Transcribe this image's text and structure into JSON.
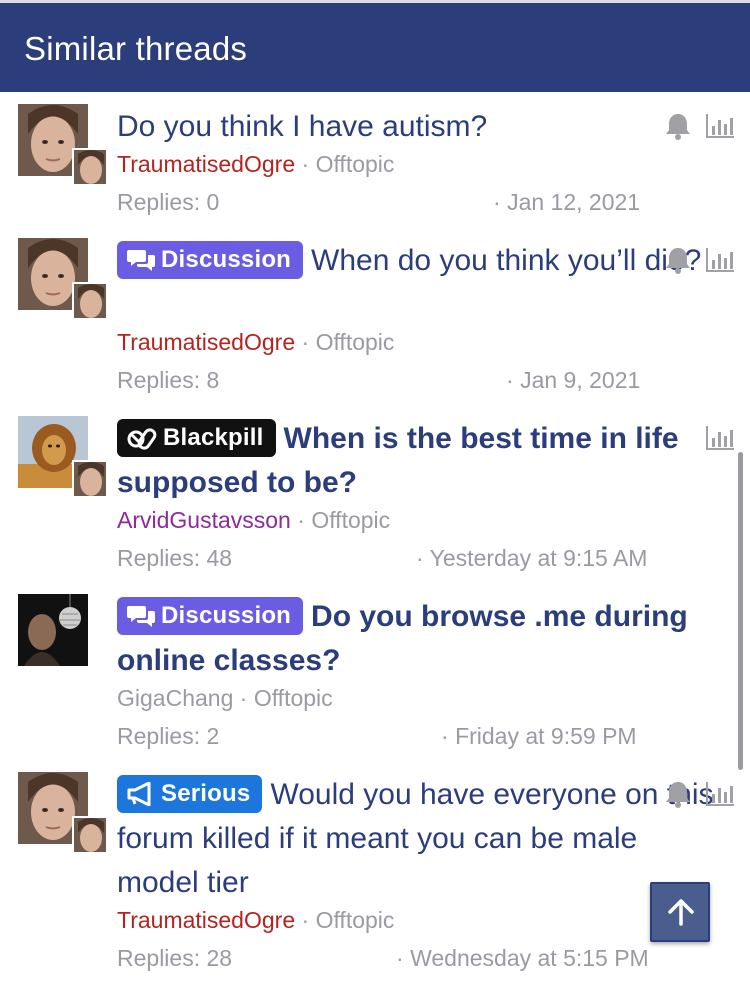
{
  "header": {
    "title": "Similar threads"
  },
  "colors": {
    "header_bg": "#2b3d7a",
    "title": "#2b3d7a",
    "discussion": "#6b5ce4",
    "blackpill": "#111111",
    "serious": "#1d76dc",
    "user_red": "#b5231f",
    "user_purple": "#8e2a9b",
    "muted": "#9a9aa3"
  },
  "threads": [
    {
      "prefix": "",
      "title": "Do you think I have autism?",
      "author": "TraumatisedOgre",
      "forum": "Offtopic",
      "replies": "Replies: 0",
      "date": "Jan 12, 2021",
      "icons": [
        "bell-icon",
        "chart-icon"
      ]
    },
    {
      "prefix": "Discussion",
      "title": "When do you think you’ll die?",
      "author": "TraumatisedOgre",
      "forum": "Offtopic",
      "replies": "Replies: 8",
      "date": "Jan 9, 2021",
      "icons": [
        "bell-icon",
        "chart-icon"
      ]
    },
    {
      "prefix": "Blackpill",
      "title": "When is the best time in life supposed to be?",
      "author": "ArvidGustavsson",
      "forum": "Offtopic",
      "replies": "Replies: 48",
      "date": "Yesterday at 9:15 AM",
      "icons": [
        "chart-icon"
      ]
    },
    {
      "prefix": "Discussion",
      "title": "Do you browse .me during online classes?",
      "author": "GigaChang",
      "forum": "Offtopic",
      "replies": "Replies: 2",
      "date": "Friday at 9:59 PM",
      "icons": []
    },
    {
      "prefix": "Serious",
      "title": "Would you have everyone on this forum killed if it meant you can be male model tier",
      "author": "TraumatisedOgre",
      "forum": "Offtopic",
      "replies": "Replies: 28",
      "date": "Wednesday at 5:15 PM",
      "icons": [
        "bell-icon",
        "chart-icon"
      ]
    }
  ],
  "separator": "·",
  "scroll_top": {
    "icon": "arrow-up-icon"
  }
}
